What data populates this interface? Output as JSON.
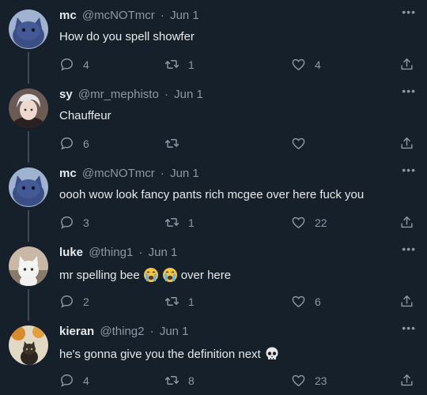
{
  "tweets": [
    {
      "name": "mc",
      "handle": "@mcNOTmcr",
      "date": "Jun 1",
      "text": "How do you spell showfer",
      "replies": "4",
      "retweets": "1",
      "likes": "4",
      "avatar": "blue-cat"
    },
    {
      "name": "sy",
      "handle": "@mr_mephisto",
      "date": "Jun 1",
      "text": "Chauffeur",
      "replies": "6",
      "retweets": "",
      "likes": "",
      "avatar": "anime-boy"
    },
    {
      "name": "mc",
      "handle": "@mcNOTmcr",
      "date": "Jun 1",
      "text": "oooh wow look fancy pants rich mcgee over here fuck you",
      "replies": "3",
      "retweets": "1",
      "likes": "22",
      "avatar": "blue-cat"
    },
    {
      "name": "luke",
      "handle": "@thing1",
      "date": "Jun 1",
      "text": "mr spelling bee",
      "text_after": "over here",
      "replies": "2",
      "retweets": "1",
      "likes": "6",
      "avatar": "white-cat"
    },
    {
      "name": "kieran",
      "handle": "@thing2",
      "date": "Jun 1",
      "text": "he's gonna give you the definition next",
      "replies": "4",
      "retweets": "8",
      "likes": "23",
      "avatar": "black-cat"
    }
  ],
  "separator": "·",
  "more_glyph": "•••",
  "colors": {
    "background": "#15202b",
    "text": "#e7e9ea",
    "muted": "#8b98a5",
    "thread_line": "#3e4a56"
  }
}
